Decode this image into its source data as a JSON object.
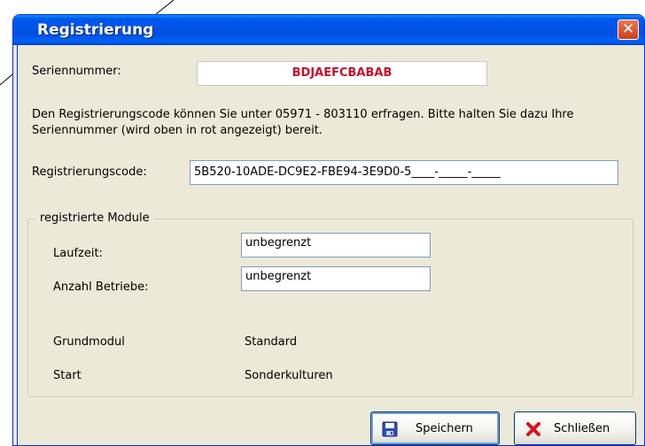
{
  "window": {
    "title": "Registrierung"
  },
  "serial": {
    "label": "Seriennummer:",
    "value": "BDJAEFCBABAB"
  },
  "info_text": "Den Registrierungscode können Sie unter 05971 - 803110 erfragen. Bitte halten Sie dazu Ihre Seriennummer (wird oben in rot angezeigt) bereit.",
  "regcode": {
    "label": "Registrierungscode:",
    "value": "5B520-10ADE-DC9E2-FBE94-3E9D0-5____-_____-_____"
  },
  "modules": {
    "legend": "registrierte Module",
    "laufzeit": {
      "label": "Laufzeit:",
      "value": "unbegrenzt"
    },
    "betriebe": {
      "label": "Anzahl Betriebe:",
      "value": "unbegrenzt"
    },
    "grundmodul": {
      "label": "Grundmodul",
      "value": "Standard"
    },
    "start": {
      "label": "Start",
      "value": "Sonderkulturen"
    }
  },
  "buttons": {
    "save": "Speichern",
    "close": "Schließen"
  },
  "colors": {
    "serial_text": "#c8102e",
    "titlebar": "#0053e8"
  }
}
